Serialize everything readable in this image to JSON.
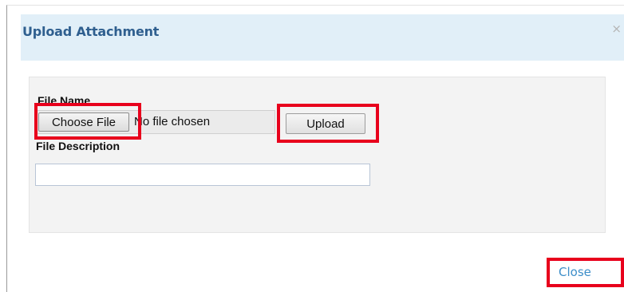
{
  "dialog": {
    "title": "Upload Attachment",
    "close_icon_glyph": "×",
    "close_icon": "close-icon"
  },
  "form": {
    "file_name_label": "File Name",
    "choose_file_label": "Choose File",
    "no_file_text": "No file chosen",
    "upload_label": "Upload",
    "file_description_label": "File Description",
    "file_description_value": ""
  },
  "footer": {
    "close_label": "Close"
  },
  "colors": {
    "header_bg": "#e1eff8",
    "title": "#2f5f8f",
    "link": "#3d8ec9",
    "highlight": "#e8001c"
  }
}
